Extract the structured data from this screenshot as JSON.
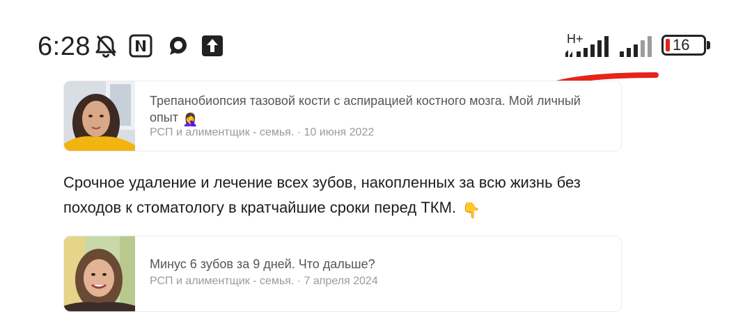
{
  "status_bar": {
    "time": "6:28",
    "network_type": "H+",
    "battery_level": "16",
    "icons": [
      "bell-muted-icon",
      "nfc-icon",
      "chat-bubble-icon",
      "upload-icon",
      "signal-icon",
      "battery-icon"
    ],
    "colors": {
      "battery_low": "#e0241b",
      "annotation_stroke": "#e8231a"
    }
  },
  "feed": {
    "cards": [
      {
        "title": "Трепанобиопсия тазовой кости с аспирацией костного мозга. Мой личный опыт",
        "emoji": "🤦‍♀️",
        "author": "РСП и алиментщик - семья.",
        "date": "10 июня 2022"
      },
      {
        "title": "Минус 6 зубов за 9 дней. Что дальше?",
        "author": "РСП и алиментщик - семья.",
        "date": "7 апреля 2024"
      }
    ],
    "paragraph": "Срочное удаление и лечение всех зубов, накопленных за всю жизнь без походов к стоматологу в кратчайшие сроки перед ТКМ.",
    "paragraph_emoji": "👇"
  }
}
